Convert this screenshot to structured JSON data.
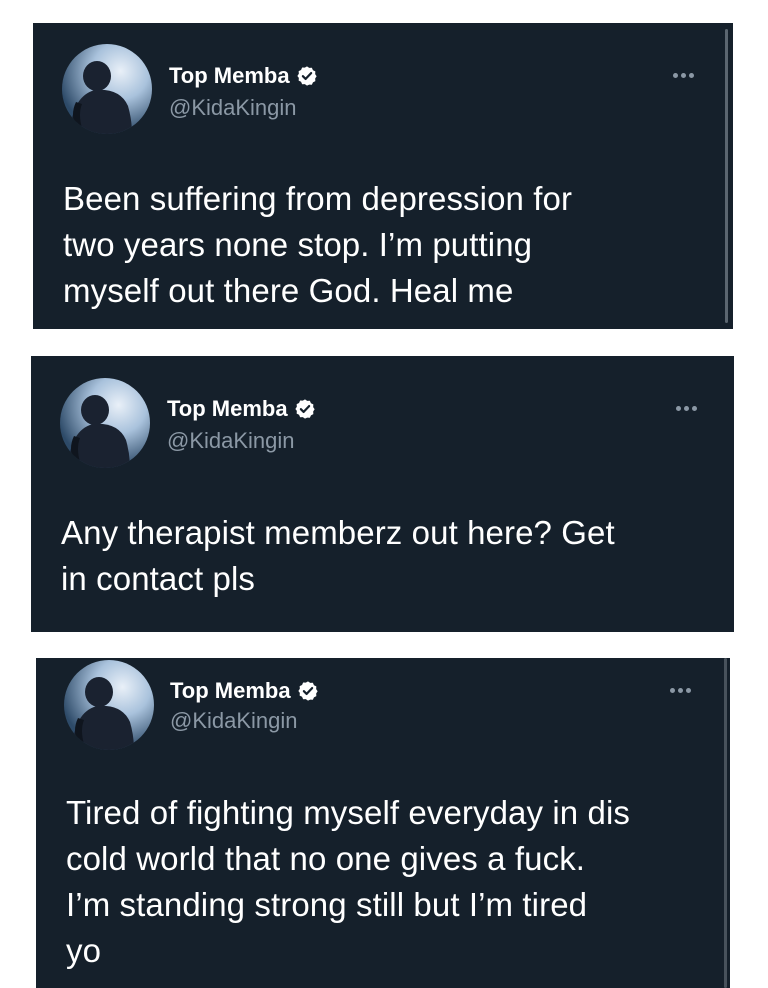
{
  "tweets": [
    {
      "name": "Top Memba",
      "handle": "@KidaKingin",
      "verified_icon": "verified-badge-icon",
      "more_icon": "more-options-icon",
      "lines": [
        "Been suffering from depression for",
        "two years none stop. I’m putting",
        "myself out there God. Heal me"
      ]
    },
    {
      "name": "Top Memba",
      "handle": "@KidaKingin",
      "verified_icon": "verified-badge-icon",
      "more_icon": "more-options-icon",
      "lines": [
        "Any therapist memberz out here? Get",
        "in contact pls"
      ]
    },
    {
      "name": "Top Memba",
      "handle": "@KidaKingin",
      "verified_icon": "verified-badge-icon",
      "more_icon": "more-options-icon",
      "lines": [
        "Tired of fighting myself everyday in dis",
        "cold world that no one gives a fuck.",
        "I’m standing strong still but I’m tired",
        "yo"
      ]
    }
  ],
  "colors": {
    "background": "#15202b",
    "name": "#ffffff",
    "handle": "#8b98a5",
    "verified": "#ffffff"
  }
}
